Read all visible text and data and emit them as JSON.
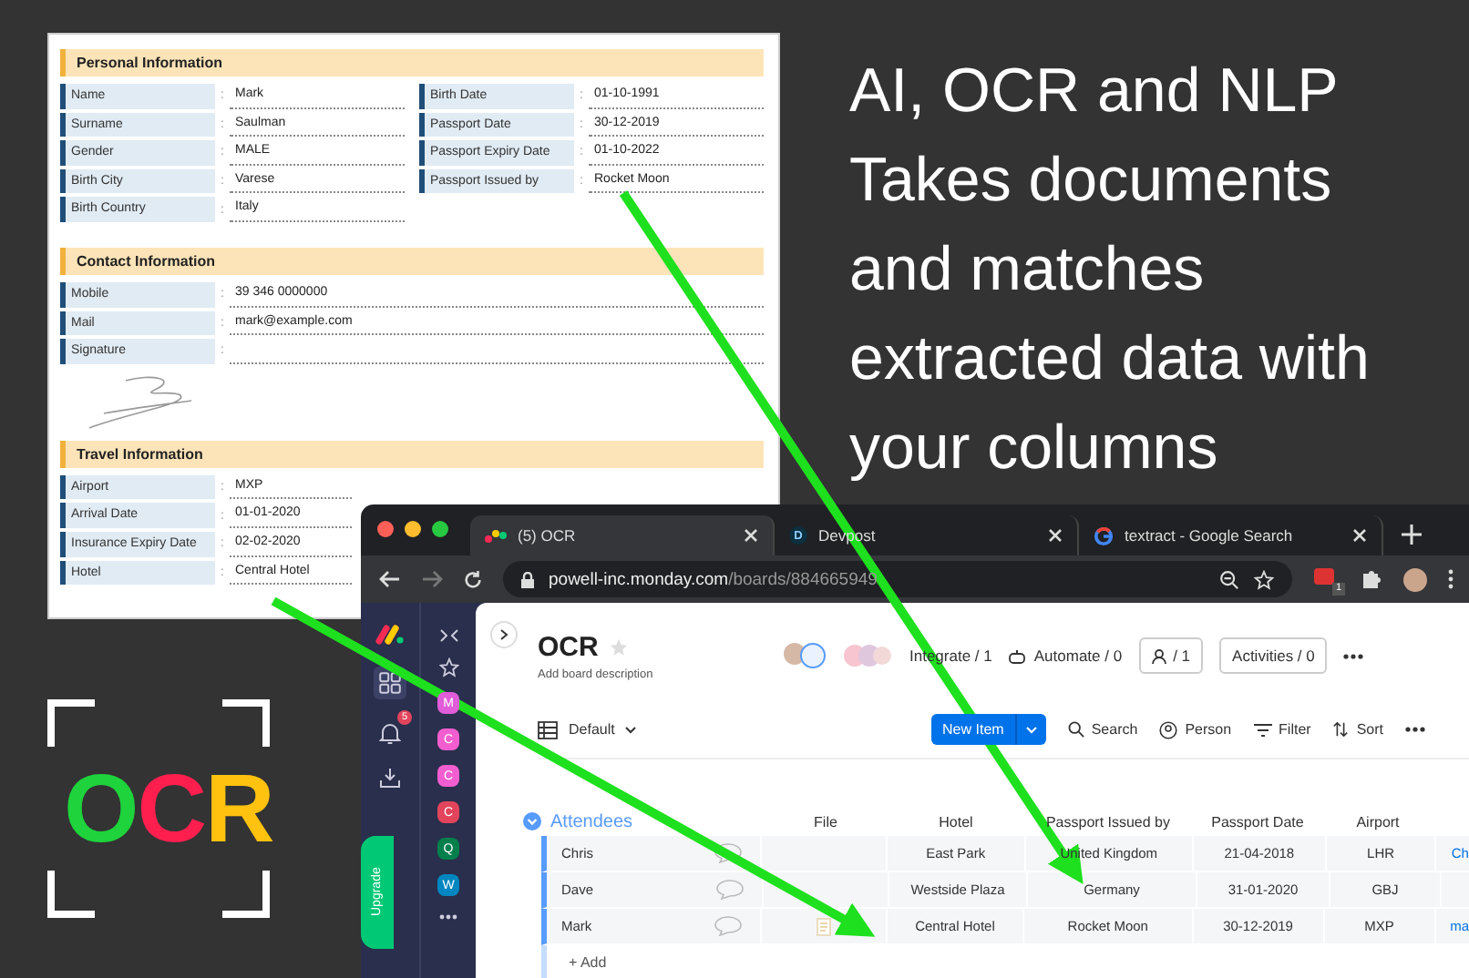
{
  "headline": "AI, OCR and NLP Takes documents and matches extracted data with your columns",
  "logo": {
    "letters": [
      {
        "text": "O",
        "color": "#1ed33c"
      },
      {
        "text": "C",
        "color": "#ff1f4f"
      },
      {
        "text": "R",
        "color": "#ffc20e"
      }
    ]
  },
  "document": {
    "sections": [
      {
        "title": "Personal Information",
        "kind": "paired",
        "left": [
          {
            "label": "Name",
            "sep": ":",
            "value": "Mark"
          },
          {
            "label": "Surname",
            "sep": ":",
            "value": "Saulman"
          },
          {
            "label": "Gender",
            "sep": ":",
            "value": "MALE"
          },
          {
            "label": "Birth City",
            "sep": ":",
            "value": "Varese"
          },
          {
            "label": "Birth Country",
            "sep": ":",
            "value": "Italy"
          }
        ],
        "right": [
          {
            "label": "Birth Date",
            "sep": ":",
            "value": "01-10-1991"
          },
          {
            "label": "Passport Date",
            "sep": ":",
            "value": "30-12-2019"
          },
          {
            "label": "Passport Expiry Date",
            "sep": ":",
            "value": "01-10-2022"
          },
          {
            "label": "Passport Issued by",
            "sep": ":",
            "value": "Rocket Moon"
          }
        ]
      },
      {
        "title": "Contact Information",
        "kind": "wide",
        "left": [
          {
            "label": "Mobile",
            "sep": ":",
            "value": "39 346 0000000"
          },
          {
            "label": "Mail",
            "sep": ":",
            "value": "mark@example.com"
          },
          {
            "label": "Signature",
            "sep": ":"
          }
        ],
        "signature": true
      },
      {
        "title": "Travel Information",
        "kind": "narrow",
        "left": [
          {
            "label": "Airport",
            "sep": ":",
            "value": "MXP"
          },
          {
            "label": "Arrival Date",
            "sep": ":",
            "value": "01-01-2020"
          },
          {
            "label": "Insurance Expiry Date",
            "sep": ":",
            "value": "02-02-2020"
          },
          {
            "label": "Hotel",
            "sep": ":",
            "value": "Central Hotel"
          }
        ]
      }
    ]
  },
  "browser": {
    "tabs": [
      {
        "title": "(5) OCR",
        "kind": "monday",
        "selected": true
      },
      {
        "title": "Devpost",
        "kind": "letter",
        "icon_text": "D",
        "selected": false
      },
      {
        "title": "textract - Google Search",
        "kind": "google",
        "selected": false
      }
    ],
    "url": {
      "host": "powell-inc.monday.com",
      "path": "/boards/884665949"
    },
    "extension_badge": "1",
    "notification_badge": "5",
    "workspaces": [
      {
        "letter": "M",
        "color": "#e05cd9"
      },
      {
        "letter": "C",
        "color": "#f25ed0"
      },
      {
        "letter": "C",
        "color": "#f25ed0"
      },
      {
        "letter": "C",
        "color": "#e2445c"
      },
      {
        "letter": "Q",
        "color": "#037f4c"
      },
      {
        "letter": "W",
        "color": "#0086c0"
      }
    ],
    "upgrade": "Upgrade",
    "board": {
      "title": "OCR",
      "description": "Add board description",
      "integrate": "Integrate / 1",
      "automate": "Automate / 0",
      "members": "/ 1",
      "activities": "Activities / 0"
    },
    "toolbar": {
      "view": "Default",
      "new_item": "New Item",
      "search": "Search",
      "person": "Person",
      "filter": "Filter",
      "sort": "Sort"
    },
    "group": {
      "title": "Attendees",
      "file_column": "File",
      "columns": [
        "Hotel",
        "Passport Issued by",
        "Passport Date",
        "Airport"
      ],
      "rows": [
        {
          "name": "Chris",
          "file": false,
          "cells": [
            "East Park",
            "United Kingdom",
            "21-04-2018",
            "LHR"
          ],
          "extra": "Ch"
        },
        {
          "name": "Dave",
          "file": false,
          "cells": [
            "Westside Plaza",
            "Germany",
            "31-01-2020",
            "GBJ"
          ]
        },
        {
          "name": "Mark",
          "file": true,
          "cells": [
            "Central Hotel",
            "Rocket Moon",
            "30-12-2019",
            "MXP"
          ],
          "extra": "ma"
        }
      ],
      "add": "+ Add"
    }
  }
}
